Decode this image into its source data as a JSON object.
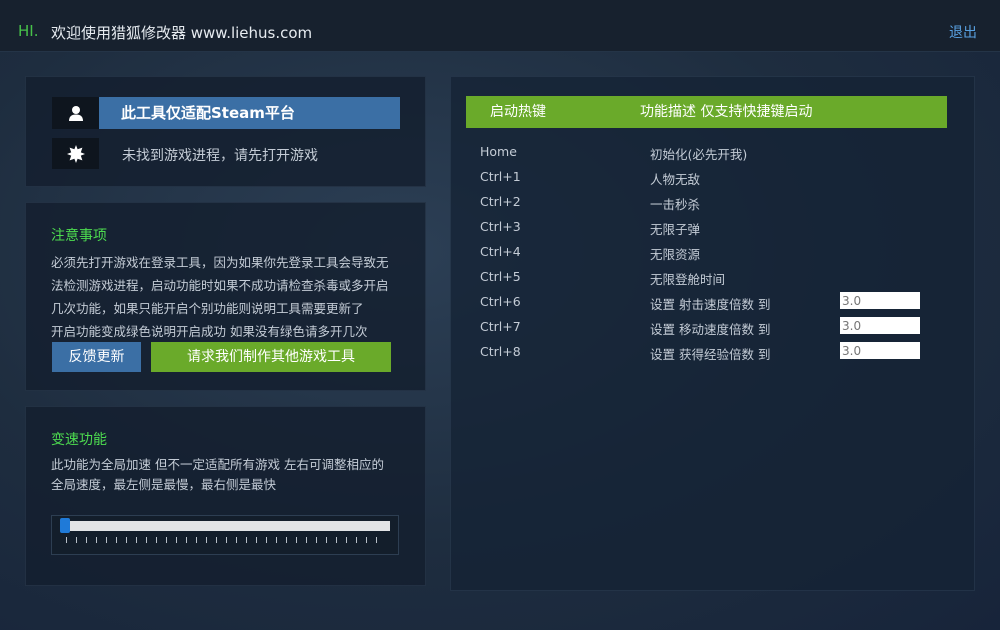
{
  "header": {
    "hi": "HI.",
    "welcome": "欢迎使用猎狐修改器 www.liehus.com",
    "logout": "退出"
  },
  "status": {
    "platform": "此工具仅适配Steam平台",
    "process": "未找到游戏进程，请先打开游戏"
  },
  "notice": {
    "title": "注意事项",
    "lines": [
      "必须先打开游戏在登录工具，因为如果你先登录工具会导致无",
      "法检测游戏进程，启动功能时如果不成功请检查杀毒或多开启",
      "几次功能，如果只能开启个别功能则说明工具需要更新了",
      "开启功能变成绿色说明开启成功 如果没有绿色请多开几次"
    ],
    "feedback_btn": "反馈更新",
    "request_btn": "请求我们制作其他游戏工具"
  },
  "speed": {
    "title": "变速功能",
    "lines": [
      "此功能为全局加速 但不一定适配所有游戏 左右可调整相应的",
      "全局速度，最左侧是最慢，最右侧是最快"
    ]
  },
  "hotkeys": {
    "col_key": "启动热键",
    "col_desc": "功能描述 仅支持快捷键启动",
    "rows": [
      {
        "key": "Home",
        "desc": "初始化(必先开我)"
      },
      {
        "key": "Ctrl+1",
        "desc": "人物无敌"
      },
      {
        "key": "Ctrl+2",
        "desc": "一击秒杀"
      },
      {
        "key": "Ctrl+3",
        "desc": "无限子弹"
      },
      {
        "key": "Ctrl+4",
        "desc": "无限资源"
      },
      {
        "key": "Ctrl+5",
        "desc": "无限登舱时间"
      },
      {
        "key": "Ctrl+6",
        "desc": "设置 射击速度倍数 到",
        "placeholder": "3.0"
      },
      {
        "key": "Ctrl+7",
        "desc": "设置 移动速度倍数 到",
        "placeholder": "3.0"
      },
      {
        "key": "Ctrl+8",
        "desc": "设置 获得经验倍数 到",
        "placeholder": "3.0"
      }
    ]
  },
  "colors": {
    "accent_green": "#6aaa2a",
    "title_green": "#4ddc4f",
    "accent_blue": "#3b6fa5"
  }
}
